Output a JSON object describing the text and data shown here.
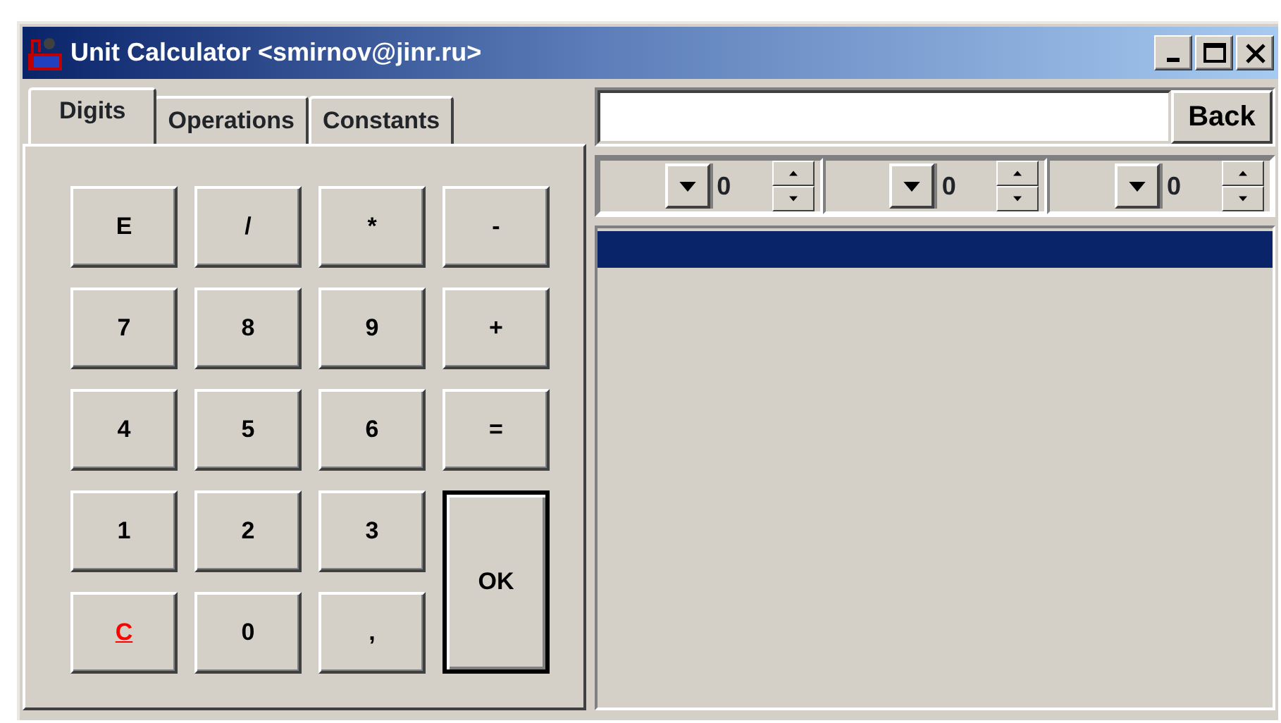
{
  "window": {
    "title": "Unit Calculator <smirnov@jinr.ru>"
  },
  "tabs": [
    {
      "label": "Digits",
      "selected": true
    },
    {
      "label": "Operations",
      "selected": false
    },
    {
      "label": "Constants",
      "selected": false
    }
  ],
  "keys": [
    {
      "label": "E",
      "kind": "normal"
    },
    {
      "label": "/",
      "kind": "normal"
    },
    {
      "label": "*",
      "kind": "normal"
    },
    {
      "label": "-",
      "kind": "normal"
    },
    {
      "label": "7",
      "kind": "normal"
    },
    {
      "label": "8",
      "kind": "normal"
    },
    {
      "label": "9",
      "kind": "normal"
    },
    {
      "label": "+",
      "kind": "normal"
    },
    {
      "label": "4",
      "kind": "normal"
    },
    {
      "label": "5",
      "kind": "normal"
    },
    {
      "label": "6",
      "kind": "normal"
    },
    {
      "label": "=",
      "kind": "normal"
    },
    {
      "label": "1",
      "kind": "normal"
    },
    {
      "label": "2",
      "kind": "normal"
    },
    {
      "label": "3",
      "kind": "normal"
    },
    {
      "label": "OK",
      "kind": "ok"
    },
    {
      "label": "C",
      "kind": "clear"
    },
    {
      "label": "0",
      "kind": "normal"
    },
    {
      "label": ",",
      "kind": "normal"
    }
  ],
  "back_button": "Back",
  "spinners": [
    {
      "value": "0"
    },
    {
      "value": "0"
    },
    {
      "value": "0"
    }
  ],
  "result_list": {
    "rows": [
      {
        "selected": true
      }
    ]
  }
}
